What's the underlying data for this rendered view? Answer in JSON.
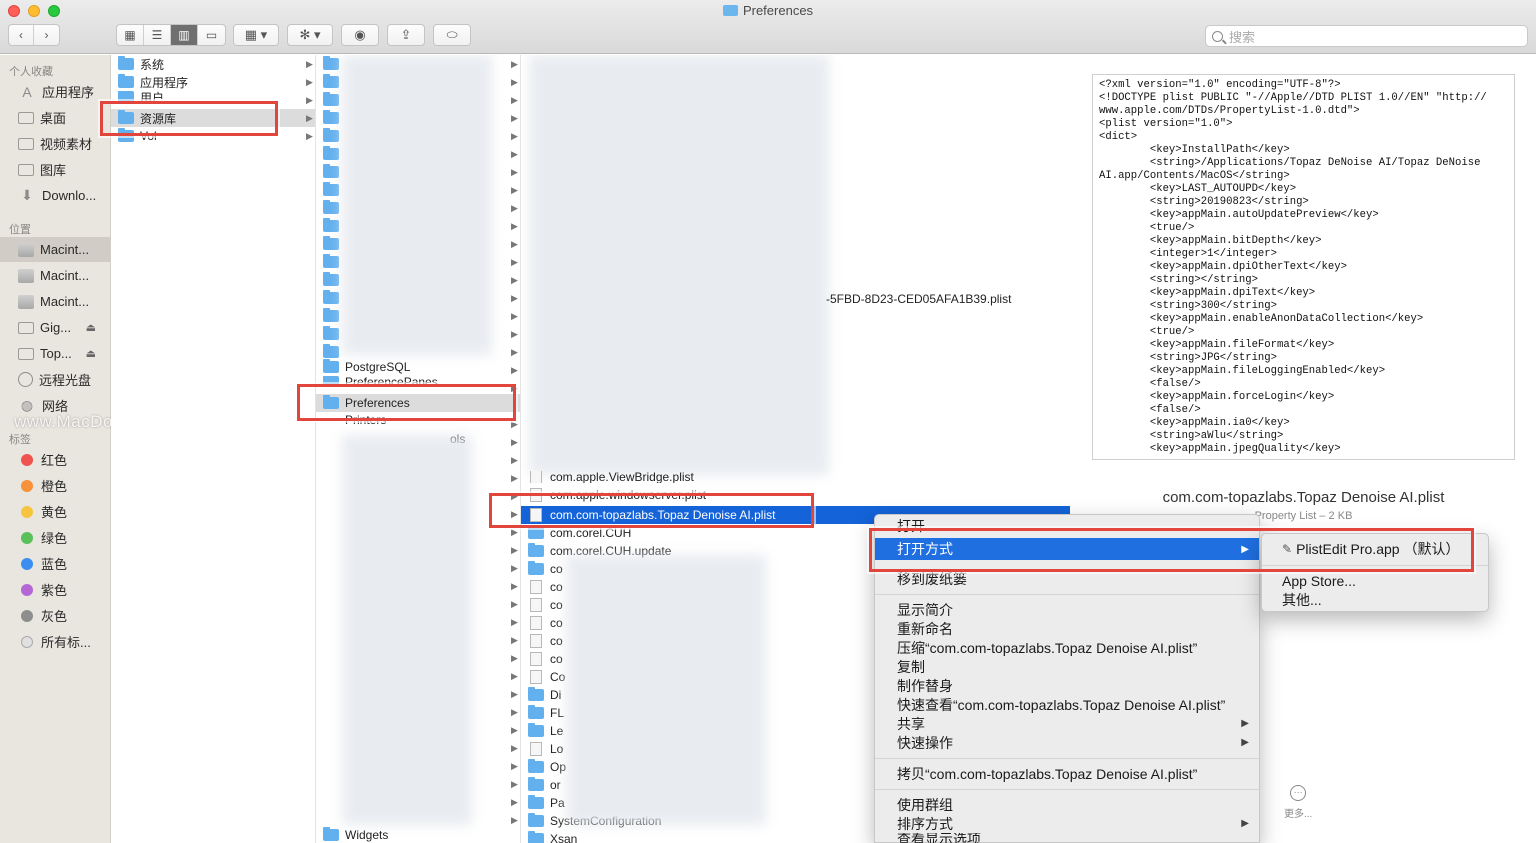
{
  "window": {
    "title": "Preferences"
  },
  "toolbar": {
    "back_icon": "chevron-left-icon",
    "forward_icon": "chevron-right-icon",
    "view_modes": [
      "icon-view-icon",
      "list-view-icon",
      "column-view-icon",
      "gallery-view-icon"
    ],
    "group_icon": "group-icon",
    "action_icon": "gear-icon",
    "quicklook_icon": "eye-icon",
    "share_icon": "share-icon",
    "tag_icon": "tag-icon",
    "search_placeholder": "搜索"
  },
  "sidebar": {
    "favorites_header": "个人收藏",
    "favorites": [
      "应用程序",
      "桌面",
      "视频素材",
      "图库",
      "Downlo..."
    ],
    "locations_header": "位置",
    "locations": [
      "Macint...",
      "Macint...",
      "Macint...",
      "Gig...",
      "Top...",
      "远程光盘",
      "网络"
    ],
    "tags_header": "标签",
    "tags": [
      {
        "label": "红色",
        "color": "#f0524f"
      },
      {
        "label": "橙色",
        "color": "#f7913a"
      },
      {
        "label": "黄色",
        "color": "#f5c540"
      },
      {
        "label": "绿色",
        "color": "#5ac05a"
      },
      {
        "label": "蓝色",
        "color": "#3b8ef0"
      },
      {
        "label": "紫色",
        "color": "#b467d4"
      },
      {
        "label": "灰色",
        "color": "#8e8e8e"
      },
      {
        "label": "所有标...",
        "color": "#cfcfcf"
      }
    ]
  },
  "column1": {
    "items": [
      "系统",
      "应用程序",
      "用户",
      "资源库",
      "Vol"
    ]
  },
  "column2": {
    "items": [
      "PostgreSQL",
      "PreferencePanes",
      "Preferences",
      "Printers",
      "ols",
      "Widgets"
    ]
  },
  "column3": {
    "partial_filename": "-5FBD-8D23-CED05AFA1B39.plist",
    "items": [
      "com.apple.ViewBridge.plist",
      "com.apple.windowserver.plist",
      "com.com-topazlabs.Topaz Denoise AI.plist",
      "com.corel.CUH",
      "com.corel.CUH.update",
      "co",
      "co",
      "co",
      "co",
      "co",
      "co",
      "Co",
      "Di",
      "FL",
      "Le",
      "Lo",
      "Op",
      "or",
      "Pa",
      "SystemConfiguration",
      "Xsan"
    ]
  },
  "preview": {
    "plist_text": "<?xml version=\"1.0\" encoding=\"UTF-8\"?>\n<!DOCTYPE plist PUBLIC \"-//Apple//DTD PLIST 1.0//EN\" \"http://\nwww.apple.com/DTDs/PropertyList-1.0.dtd\">\n<plist version=\"1.0\">\n<dict>\n        <key>InstallPath</key>\n        <string>/Applications/Topaz DeNoise AI/Topaz DeNoise\nAI.app/Contents/MacOS</string>\n        <key>LAST_AUTOUPD</key>\n        <string>20190823</string>\n        <key>appMain.autoUpdatePreview</key>\n        <true/>\n        <key>appMain.bitDepth</key>\n        <integer>1</integer>\n        <key>appMain.dpiOtherText</key>\n        <string></string>\n        <key>appMain.dpiText</key>\n        <string>300</string>\n        <key>appMain.enableAnonDataCollection</key>\n        <true/>\n        <key>appMain.fileFormat</key>\n        <string>JPG</string>\n        <key>appMain.fileLoggingEnabled</key>\n        <false/>\n        <key>appMain.forceLogin</key>\n        <false/>\n        <key>appMain.ia0</key>\n        <string>aWlu</string>\n        <key>appMain.jpegQuality</key>",
    "file_name": "com.com-topazlabs.Topaz Denoise AI.plist",
    "file_kind": "Property List – 2 KB",
    "more_label": "更多..."
  },
  "context_menu": {
    "items": [
      {
        "label": "打开"
      },
      {
        "label": "打开方式",
        "submenu": true,
        "highlighted": true
      },
      {
        "label": "移到废纸篓"
      },
      {
        "label": "显示简介"
      },
      {
        "label": "重新命名"
      },
      {
        "label": "压缩“com.com-topazlabs.Topaz Denoise AI.plist”"
      },
      {
        "label": "复制"
      },
      {
        "label": "制作替身"
      },
      {
        "label": "快速查看“com.com-topazlabs.Topaz Denoise AI.plist”"
      },
      {
        "label": "共享",
        "submenu": true
      },
      {
        "label": "快速操作",
        "submenu": true
      },
      {
        "label": "拷贝“com.com-topazlabs.Topaz Denoise AI.plist”"
      },
      {
        "label": "使用群组"
      },
      {
        "label": "排序方式",
        "submenu": true
      },
      {
        "label": "查看显示选项"
      }
    ]
  },
  "submenu": {
    "items": [
      "PlistEdit Pro.app （默认）",
      "App Store...",
      "其他..."
    ]
  },
  "watermark": "www.MacDown.com",
  "colors": {
    "selection": "#1463d8",
    "annotation": "#e2453c",
    "folder": "#63b0ee"
  }
}
